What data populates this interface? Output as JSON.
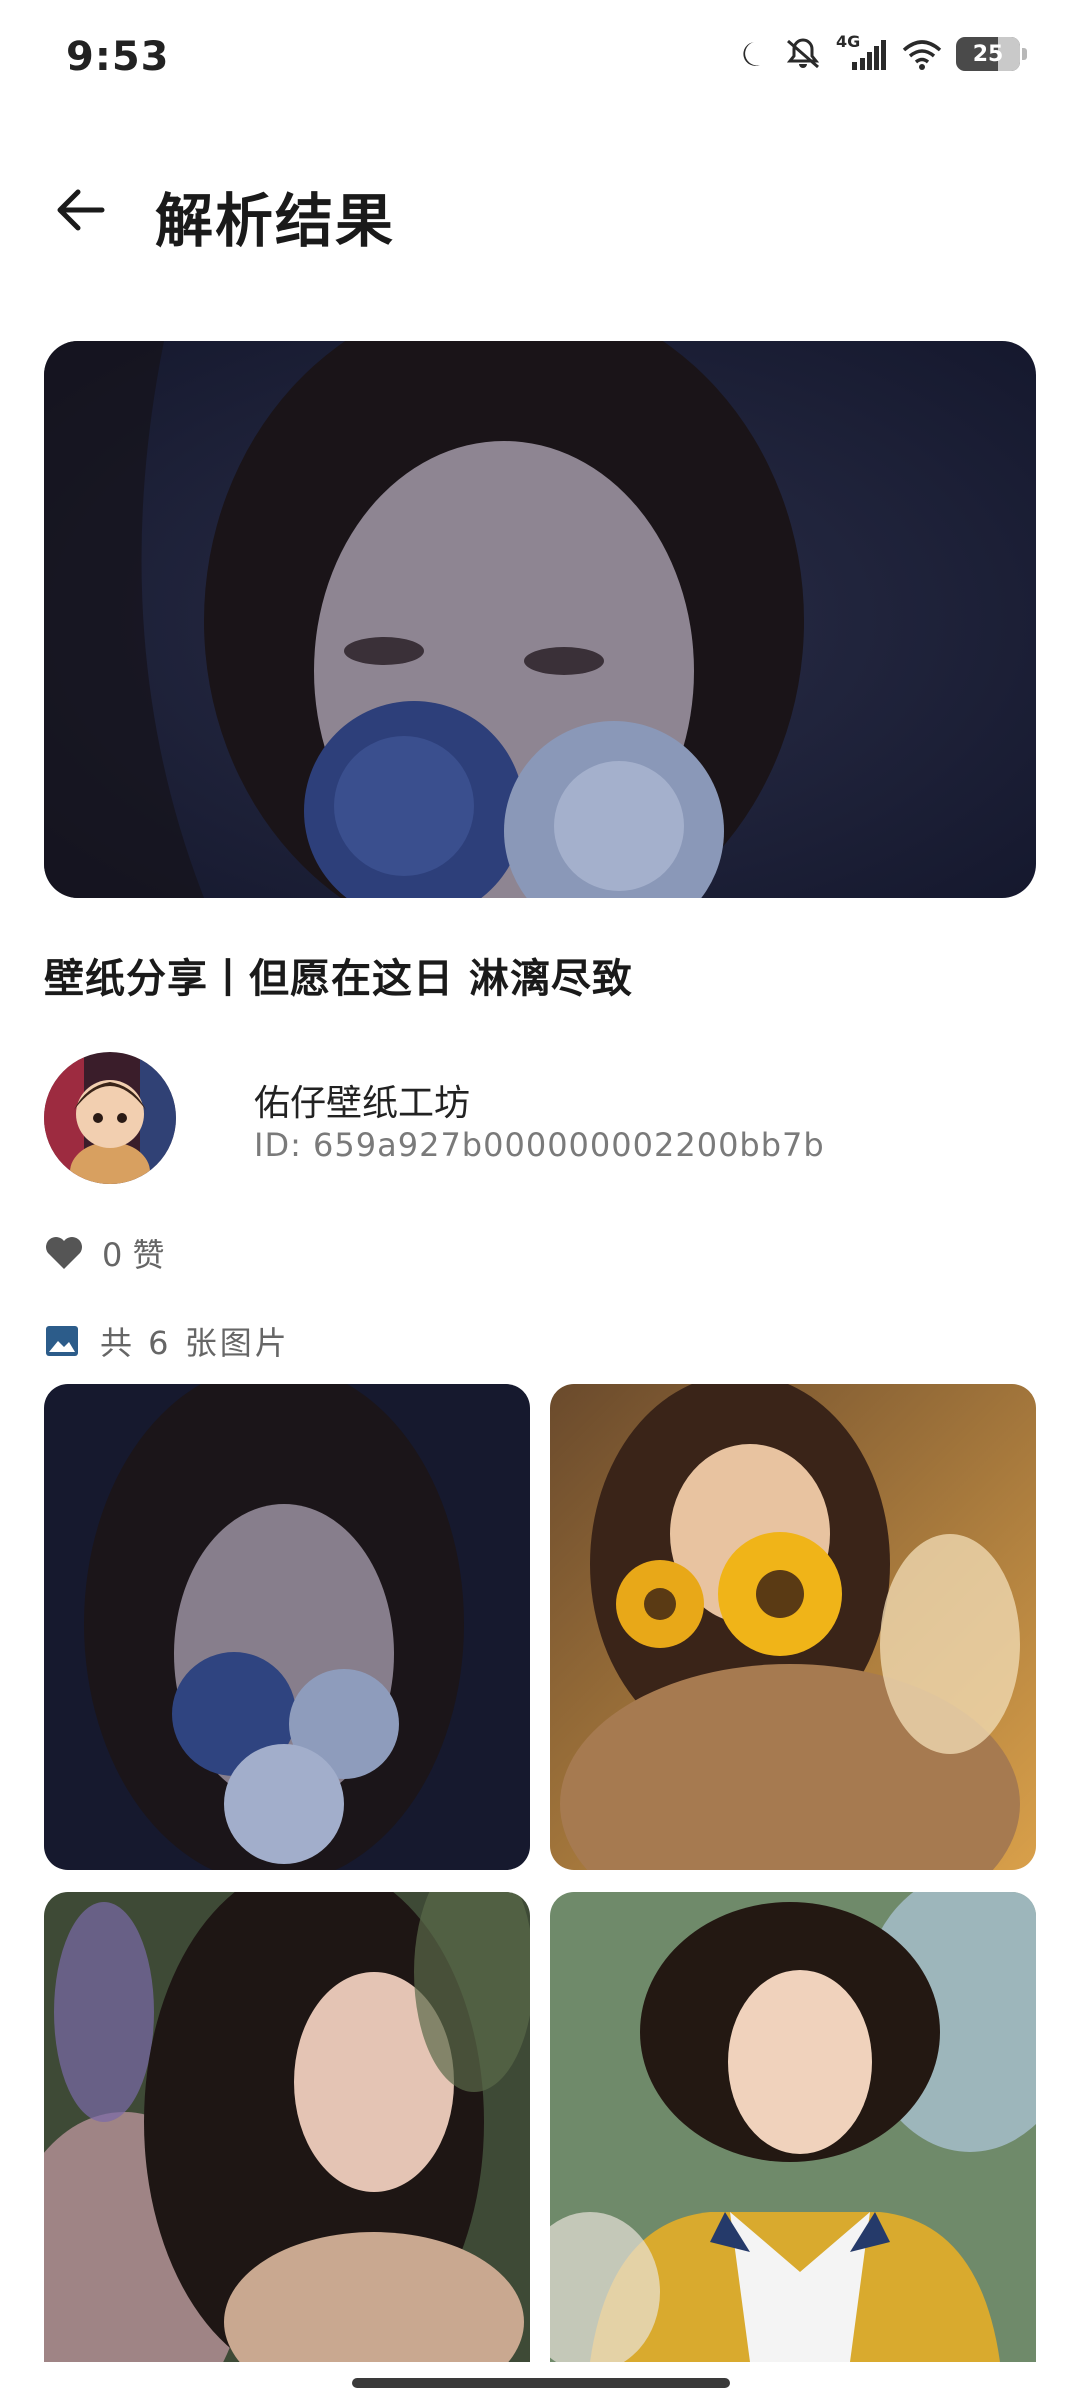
{
  "status_bar": {
    "time": "9:53",
    "network": "4G",
    "battery": "25",
    "icons": [
      "moon-icon",
      "mute-icon",
      "signal-icon",
      "wifi-icon",
      "battery-icon"
    ]
  },
  "app_bar": {
    "back_icon": "arrow-left-icon",
    "title": "解析结果"
  },
  "post": {
    "title": "壁纸分享丨但愿在这日 淋漓尽致",
    "author": {
      "name": "佑仔壁纸工坊",
      "id": "ID: 659a927b000000002200bb7b"
    },
    "likes": "0 赞",
    "image_count": "共 6 张图片"
  },
  "colors": {
    "accent": "#2c5c8a",
    "text_primary": "#1a1a1a",
    "text_secondary": "#7a7a7a"
  }
}
